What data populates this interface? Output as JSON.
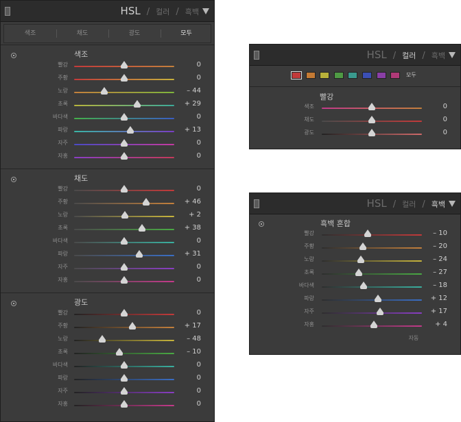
{
  "colors": {
    "red": "#c23a3a",
    "orange": "#c47a34",
    "yellow": "#b9b13a",
    "green": "#4f9a44",
    "aqua": "#3a9a8e",
    "blue": "#3b4fb5",
    "purple": "#8a3fa6",
    "magenta": "#b03a78"
  },
  "panel1": {
    "header": {
      "hsl": "HSL",
      "sep1": "/",
      "color": "컬러",
      "sep2": "/",
      "bw": "흑백"
    },
    "tabs": [
      "색조",
      "채도",
      "광도",
      "모두"
    ],
    "sections": [
      {
        "title": "색조",
        "rows": [
          {
            "label": "빨강",
            "value": "0",
            "pos": 0.5,
            "g": [
              "#c33a3a",
              "#c4803c"
            ]
          },
          {
            "label": "주황",
            "value": "0",
            "pos": 0.5,
            "g": [
              "#c33a3a",
              "#c8b23c"
            ]
          },
          {
            "label": "노랑",
            "value": "– 44",
            "pos": 0.3,
            "g": [
              "#c4803c",
              "#7fb53c"
            ]
          },
          {
            "label": "초록",
            "value": "+ 29",
            "pos": 0.63,
            "g": [
              "#b8b53c",
              "#3caa9a"
            ]
          },
          {
            "label": "바다색",
            "value": "0",
            "pos": 0.5,
            "g": [
              "#44b04a",
              "#3a5ec4"
            ]
          },
          {
            "label": "파랑",
            "value": "+ 13",
            "pos": 0.56,
            "g": [
              "#3ab6a6",
              "#7a3ec4"
            ]
          },
          {
            "label": "자주",
            "value": "0",
            "pos": 0.5,
            "g": [
              "#4a4ac4",
              "#c43aa0"
            ]
          },
          {
            "label": "자홍",
            "value": "0",
            "pos": 0.5,
            "g": [
              "#8a3ec4",
              "#c43a5a"
            ]
          }
        ]
      },
      {
        "title": "채도",
        "rows": [
          {
            "label": "빨강",
            "value": "0",
            "pos": 0.5,
            "g": [
              "#4a4a4a",
              "#c33a3a"
            ]
          },
          {
            "label": "주황",
            "value": "+ 46",
            "pos": 0.72,
            "g": [
              "#4a4a4a",
              "#c4803c"
            ]
          },
          {
            "label": "노랑",
            "value": "+ 2",
            "pos": 0.51,
            "g": [
              "#4a4a4a",
              "#c8b53c"
            ]
          },
          {
            "label": "초록",
            "value": "+ 38",
            "pos": 0.68,
            "g": [
              "#4a4a4a",
              "#4aaa44"
            ]
          },
          {
            "label": "바다색",
            "value": "0",
            "pos": 0.5,
            "g": [
              "#4a4a4a",
              "#3ab0a0"
            ]
          },
          {
            "label": "파랑",
            "value": "+ 31",
            "pos": 0.65,
            "g": [
              "#4a4a4a",
              "#3a6ec4"
            ]
          },
          {
            "label": "자주",
            "value": "0",
            "pos": 0.5,
            "g": [
              "#4a4a4a",
              "#8a3ec4"
            ]
          },
          {
            "label": "자홍",
            "value": "0",
            "pos": 0.5,
            "g": [
              "#4a4a4a",
              "#c43a8a"
            ]
          }
        ]
      },
      {
        "title": "광도",
        "rows": [
          {
            "label": "빨강",
            "value": "0",
            "pos": 0.5,
            "g": [
              "#222222",
              "#c33a3a"
            ]
          },
          {
            "label": "주황",
            "value": "+ 17",
            "pos": 0.58,
            "g": [
              "#222222",
              "#c4803c"
            ]
          },
          {
            "label": "노랑",
            "value": "– 48",
            "pos": 0.28,
            "g": [
              "#222222",
              "#c8b53c"
            ]
          },
          {
            "label": "초록",
            "value": "– 10",
            "pos": 0.45,
            "g": [
              "#222222",
              "#4aaa44"
            ]
          },
          {
            "label": "바다색",
            "value": "0",
            "pos": 0.5,
            "g": [
              "#222222",
              "#3ab0a0"
            ]
          },
          {
            "label": "파랑",
            "value": "0",
            "pos": 0.5,
            "g": [
              "#222222",
              "#3a6ec4"
            ]
          },
          {
            "label": "자주",
            "value": "0",
            "pos": 0.5,
            "g": [
              "#222222",
              "#8a3ec4"
            ]
          },
          {
            "label": "자홍",
            "value": "0",
            "pos": 0.5,
            "g": [
              "#222222",
              "#c43a8a"
            ]
          }
        ]
      }
    ]
  },
  "panel2": {
    "header": {
      "hsl": "HSL",
      "sep1": "/",
      "color": "컬러",
      "sep2": "/",
      "bw": "흑백"
    },
    "all_label": "모두",
    "title": "빨강",
    "rows": [
      {
        "label": "색조",
        "value": "0",
        "pos": 0.5,
        "g": [
          "#c33a8a",
          "#c4803c"
        ]
      },
      {
        "label": "채도",
        "value": "0",
        "pos": 0.5,
        "g": [
          "#4a4a4a",
          "#c33a3a"
        ]
      },
      {
        "label": "광도",
        "value": "0",
        "pos": 0.5,
        "g": [
          "#222222",
          "#d06a6a"
        ]
      }
    ]
  },
  "panel3": {
    "header": {
      "hsl": "HSL",
      "sep1": "/",
      "color": "컬러",
      "sep2": "/",
      "bw": "흑백"
    },
    "title": "흑백 혼합",
    "auto_label": "자동",
    "rows": [
      {
        "label": "빨강",
        "value": "– 10",
        "pos": 0.46,
        "g": [
          "#2e2e2e",
          "#c33a3a"
        ]
      },
      {
        "label": "주황",
        "value": "– 20",
        "pos": 0.41,
        "g": [
          "#2e2e2e",
          "#c4803c"
        ]
      },
      {
        "label": "노랑",
        "value": "– 24",
        "pos": 0.39,
        "g": [
          "#2e2e2e",
          "#c8b53c"
        ]
      },
      {
        "label": "초록",
        "value": "– 27",
        "pos": 0.37,
        "g": [
          "#2e2e2e",
          "#4aaa44"
        ]
      },
      {
        "label": "바다색",
        "value": "– 18",
        "pos": 0.42,
        "g": [
          "#2e2e2e",
          "#3ab0a0"
        ]
      },
      {
        "label": "파랑",
        "value": "+ 12",
        "pos": 0.56,
        "g": [
          "#2e2e2e",
          "#3a6ec4"
        ]
      },
      {
        "label": "자주",
        "value": "+ 17",
        "pos": 0.58,
        "g": [
          "#2e2e2e",
          "#8a3ec4"
        ]
      },
      {
        "label": "자홍",
        "value": "+ 4",
        "pos": 0.52,
        "g": [
          "#2e2e2e",
          "#c43a8a"
        ]
      }
    ]
  }
}
